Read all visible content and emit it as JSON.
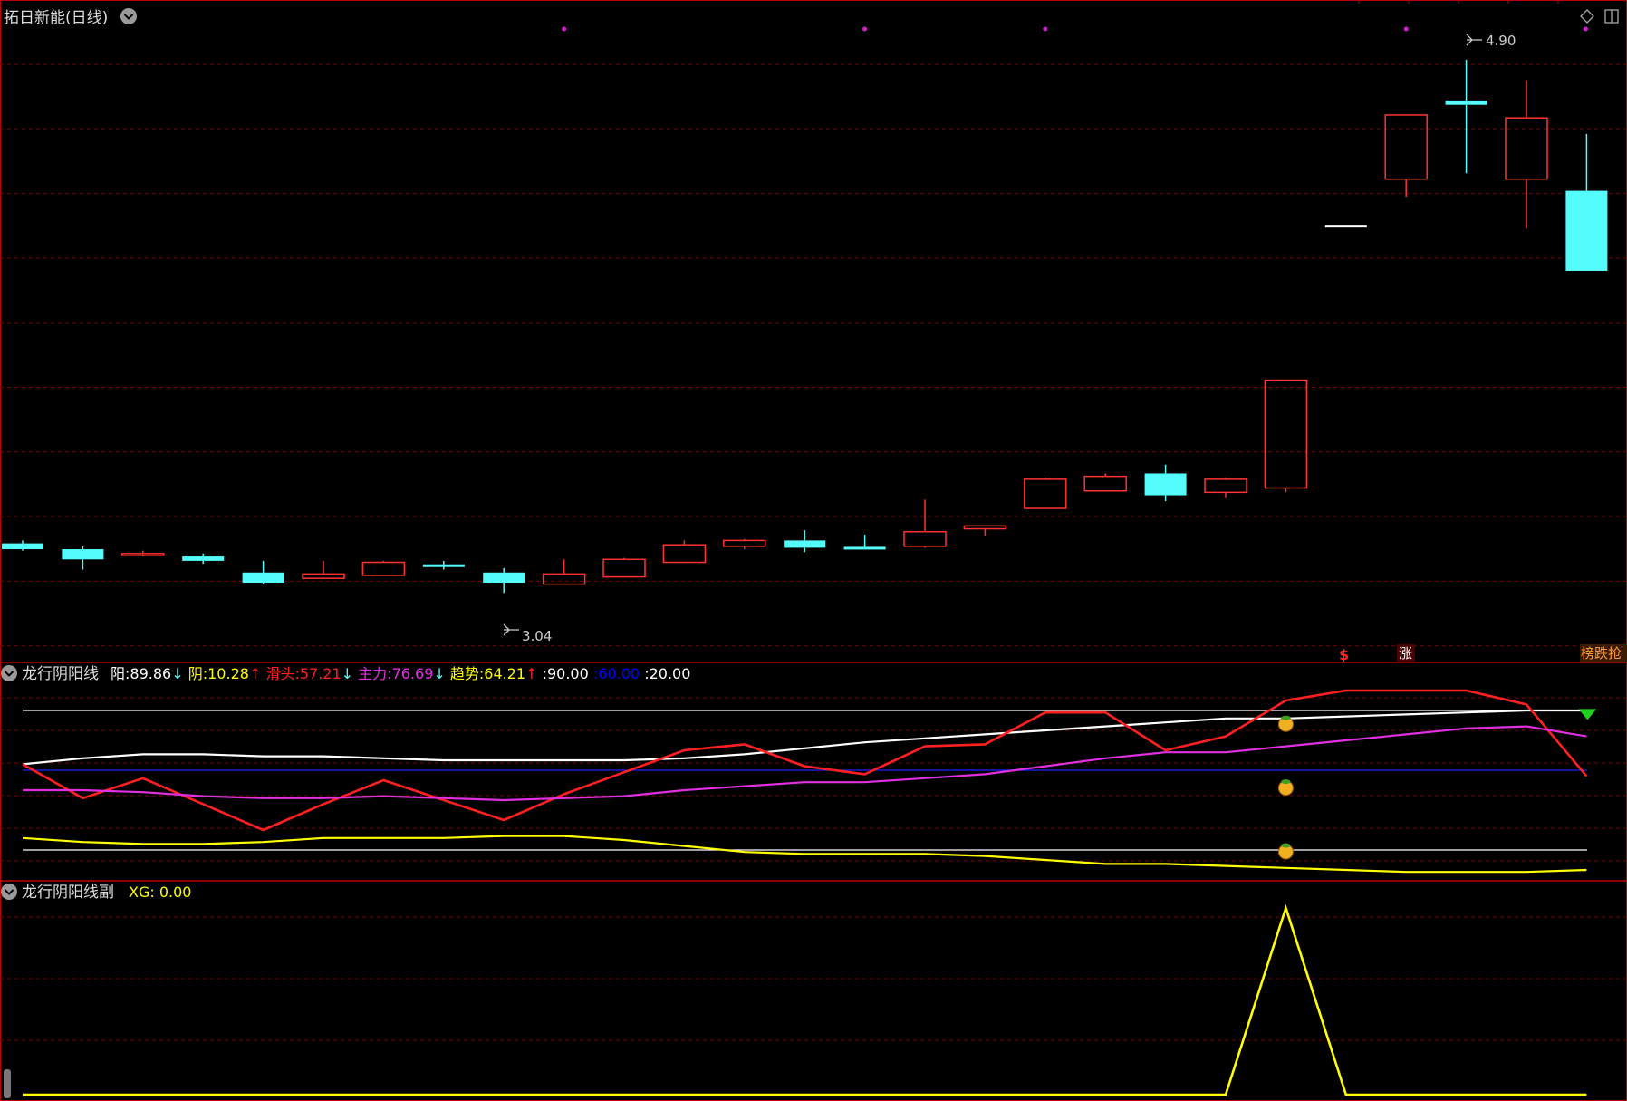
{
  "chart_data": [
    {
      "type": "candlestick",
      "title": "拓日新能(日线)",
      "ylim": [
        2.85,
        5.08
      ],
      "annotations": {
        "low_label": "3.04",
        "high_label": "4.90",
        "signals": [
          "$",
          "涨",
          "榜跌抢"
        ]
      },
      "colors": {
        "up": "#ff3333",
        "down": "#54fcfc",
        "grid": "#7a0000",
        "border": "#c00000"
      },
      "candles": [
        {
          "o": 3.24,
          "c": 3.22,
          "h": 3.25,
          "l": 3.215
        },
        {
          "o": 3.22,
          "c": 3.185,
          "h": 3.23,
          "l": 3.15
        },
        {
          "o": 3.2,
          "c": 3.205,
          "h": 3.215,
          "l": 3.195
        },
        {
          "o": 3.195,
          "c": 3.18,
          "h": 3.205,
          "l": 3.17
        },
        {
          "o": 3.14,
          "c": 3.105,
          "h": 3.18,
          "l": 3.1
        },
        {
          "o": 3.12,
          "c": 3.135,
          "h": 3.18,
          "l": 3.12
        },
        {
          "o": 3.13,
          "c": 3.175,
          "h": 3.18,
          "l": 3.13
        },
        {
          "o": 3.165,
          "c": 3.16,
          "h": 3.18,
          "l": 3.15
        },
        {
          "o": 3.14,
          "c": 3.105,
          "h": 3.155,
          "l": 3.07
        },
        {
          "o": 3.1,
          "c": 3.135,
          "h": 3.185,
          "l": 3.1
        },
        {
          "o": 3.125,
          "c": 3.185,
          "h": 3.19,
          "l": 3.125
        },
        {
          "o": 3.175,
          "c": 3.235,
          "h": 3.25,
          "l": 3.175
        },
        {
          "o": 3.23,
          "c": 3.25,
          "h": 3.255,
          "l": 3.22
        },
        {
          "o": 3.25,
          "c": 3.225,
          "h": 3.285,
          "l": 3.21
        },
        {
          "o": 3.225,
          "c": 3.22,
          "h": 3.27,
          "l": 3.22
        },
        {
          "o": 3.23,
          "c": 3.28,
          "h": 3.39,
          "l": 3.225
        },
        {
          "o": 3.29,
          "c": 3.3,
          "h": 3.3,
          "l": 3.265
        },
        {
          "o": 3.36,
          "c": 3.46,
          "h": 3.465,
          "l": 3.36
        },
        {
          "o": 3.42,
          "c": 3.47,
          "h": 3.48,
          "l": 3.42
        },
        {
          "o": 3.48,
          "c": 3.405,
          "h": 3.51,
          "l": 3.385
        },
        {
          "o": 3.415,
          "c": 3.46,
          "h": 3.465,
          "l": 3.395
        },
        {
          "o": 3.43,
          "c": 3.8,
          "h": 3.8,
          "l": 3.415
        },
        {
          "o": 4.33,
          "c": 4.33,
          "h": 4.33,
          "l": 4.33
        },
        {
          "o": 4.49,
          "c": 4.71,
          "h": 4.71,
          "l": 4.43
        },
        {
          "o": 4.76,
          "c": 4.745,
          "h": 4.9,
          "l": 4.51
        },
        {
          "o": 4.49,
          "c": 4.7,
          "h": 4.83,
          "l": 4.32
        },
        {
          "o": 4.45,
          "c": 4.175,
          "h": 4.645,
          "l": 4.175
        }
      ]
    },
    {
      "type": "line",
      "title": "龙行阴阳线",
      "legend": [
        {
          "label": "阳",
          "value": "89.86",
          "arrow": "down",
          "color": "#ffffff"
        },
        {
          "label": "阴",
          "value": "10.28",
          "arrow": "up",
          "color": "#ffff00"
        },
        {
          "label": "滑头",
          "value": "57.21",
          "arrow": "down",
          "color": "#ff2020"
        },
        {
          "label": "主力",
          "value": "76.69",
          "arrow": "down",
          "color": "#e030e0"
        },
        {
          "label": "趋势",
          "value": "64.21",
          "arrow": "up",
          "color": "#ffff00"
        },
        {
          "label": "",
          "value": "90.00",
          "arrow": "",
          "color": "#ffffff"
        },
        {
          "label": "",
          "value": "60.00",
          "arrow": "",
          "color": "#0000ff"
        },
        {
          "label": "",
          "value": "20.00",
          "arrow": "",
          "color": "#ffffff"
        }
      ],
      "ylim": [
        10,
        100
      ],
      "reference_lines": [
        90,
        60,
        20
      ],
      "series": [
        {
          "name": "阳",
          "color": "#ffffff",
          "values": [
            63,
            66,
            68,
            68,
            67,
            67,
            66,
            65,
            65,
            65,
            65,
            66,
            68,
            71,
            74,
            76,
            78,
            80,
            82,
            84,
            86,
            86,
            87,
            88,
            89,
            90,
            90
          ]
        },
        {
          "name": "阴",
          "color": "#ffff00",
          "values": [
            26,
            24,
            23,
            23,
            24,
            26,
            26,
            26,
            27,
            27,
            25,
            22,
            19,
            18,
            18,
            18,
            17,
            15,
            13,
            13,
            12,
            11,
            10,
            9,
            9,
            9,
            10
          ]
        },
        {
          "name": "滑头",
          "color": "#ff2020",
          "values": [
            63,
            46,
            56,
            43,
            30,
            43,
            55,
            45,
            35,
            48,
            59,
            70,
            73,
            62,
            58,
            72,
            73,
            89,
            89,
            70,
            77,
            95,
            100,
            100,
            100,
            93,
            57
          ]
        },
        {
          "name": "主力",
          "color": "#e030e0",
          "values": [
            50,
            50,
            49,
            47,
            46,
            46,
            47,
            46,
            45,
            46,
            47,
            50,
            52,
            54,
            54,
            56,
            58,
            62,
            66,
            69,
            69,
            72,
            75,
            78,
            81,
            82,
            77
          ]
        }
      ],
      "markers": [
        {
          "index": 21,
          "values": [
            84,
            52,
            20
          ]
        },
        {
          "index": 26,
          "type": "green-triangle",
          "value": 88
        }
      ]
    },
    {
      "type": "line",
      "title": "龙行阴阳线副",
      "legend": [
        {
          "label": "XG",
          "value": "0.00",
          "color": "#ffff00"
        }
      ],
      "ylim": [
        0,
        1
      ],
      "series": [
        {
          "name": "XG",
          "color": "#ffff00",
          "values": [
            0,
            0,
            0,
            0,
            0,
            0,
            0,
            0,
            0,
            0,
            0,
            0,
            0,
            0,
            0,
            0,
            0,
            0,
            0,
            0,
            0,
            1,
            0,
            0,
            0,
            0,
            0
          ]
        }
      ]
    }
  ]
}
